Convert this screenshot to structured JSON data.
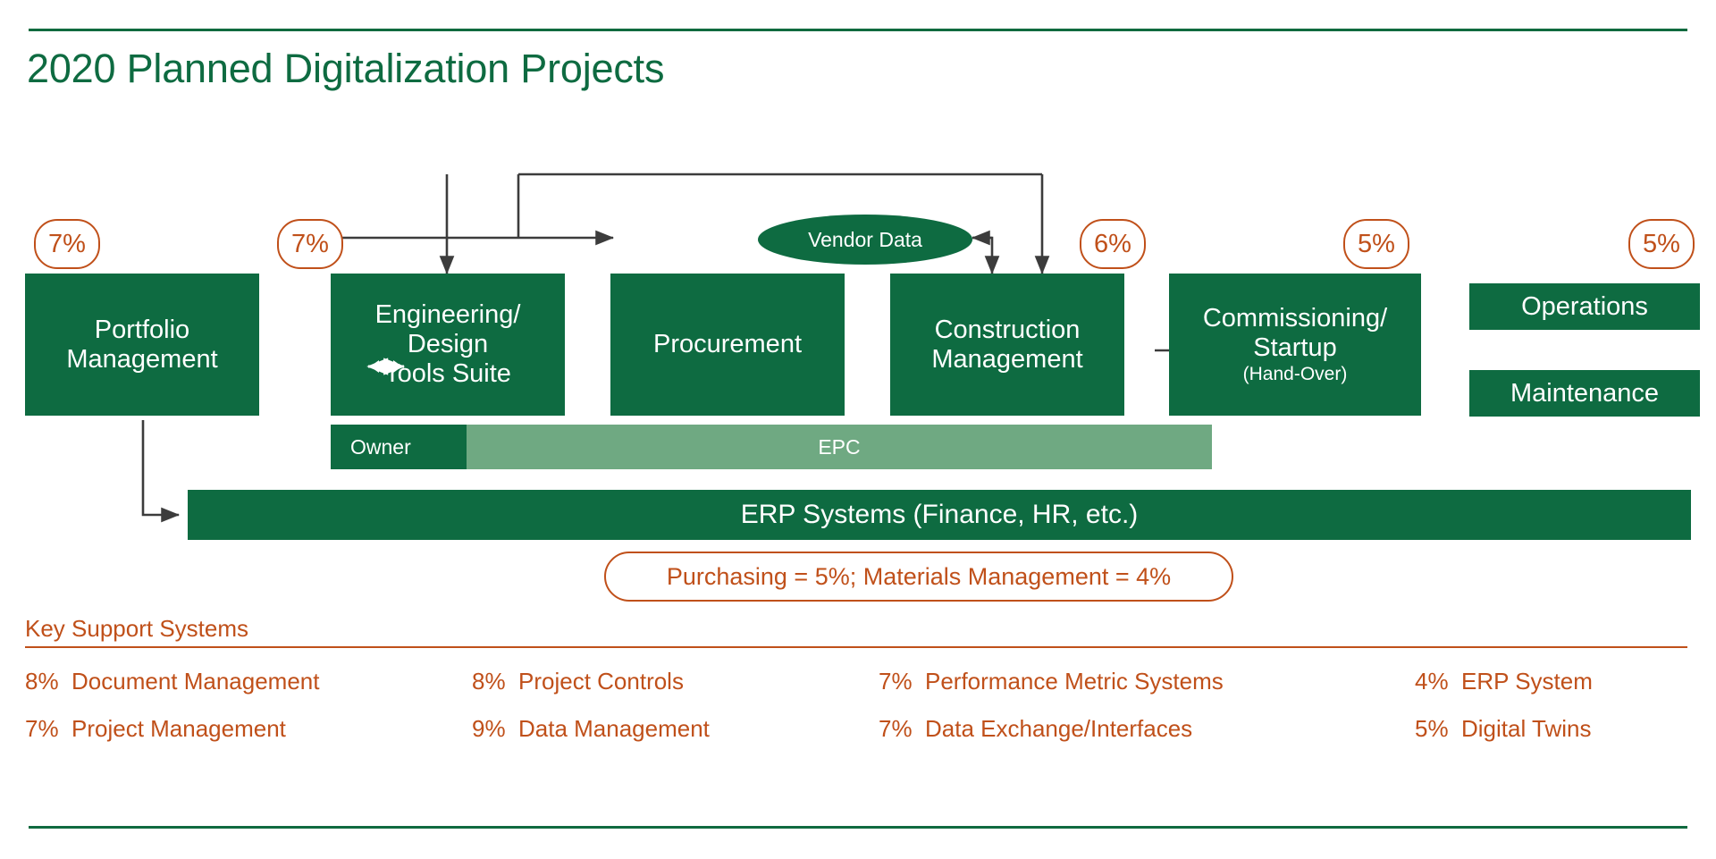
{
  "page": {
    "title": "2020 Planned Digitalization Projects",
    "accent_green": "#0E6B41",
    "accent_orange": "#C0501A",
    "epc_green": "#6FA982"
  },
  "flow": {
    "boxes": [
      {
        "id": "portfolio-management",
        "label_line1": "Portfolio",
        "label_line2": "Management",
        "percent": "7%"
      },
      {
        "id": "engineering-design-tools-suite",
        "label_line1": "Engineering/",
        "label_line2": "Design",
        "label_line3": "Tools Suite",
        "percent": "7%"
      },
      {
        "id": "procurement",
        "label_line1": "Procurement",
        "percent": ""
      },
      {
        "id": "construction-management",
        "label_line1": "Construction",
        "label_line2": "Management",
        "percent": "6%"
      },
      {
        "id": "commissioning-startup",
        "label_line1": "Commissioning/",
        "label_line2": "Startup",
        "sublabel": "(Hand-Over)",
        "percent": "5%"
      },
      {
        "id": "operations",
        "label_line1": "Operations",
        "percent": "5%"
      },
      {
        "id": "maintenance",
        "label_line1": "Maintenance",
        "percent": ""
      }
    ],
    "vendor_data": "Vendor Data",
    "owner_label": "Owner",
    "epc_label": "EPC",
    "erp_bar": "ERP Systems (Finance, HR, etc.)",
    "purchasing_note": "Purchasing = 5%; Materials Management = 4%"
  },
  "support": {
    "heading": "Key Support Systems",
    "items": [
      {
        "percent": "8%",
        "label": "Document Management"
      },
      {
        "percent": "8%",
        "label": "Project Controls"
      },
      {
        "percent": "7%",
        "label": "Performance Metric Systems"
      },
      {
        "percent": "4%",
        "label": "ERP System"
      },
      {
        "percent": "7%",
        "label": "Project Management"
      },
      {
        "percent": "9%",
        "label": "Data Management"
      },
      {
        "percent": "7%",
        "label": "Data Exchange/Interfaces"
      },
      {
        "percent": "5%",
        "label": "Digital Twins"
      }
    ]
  },
  "chart_data": {
    "type": "diagram",
    "title": "2020 Planned Digitalization Projects",
    "process_stages": [
      {
        "name": "Portfolio Management",
        "percent": 7
      },
      {
        "name": "Engineering/Design Tools Suite",
        "percent": 7
      },
      {
        "name": "Procurement",
        "percent": null
      },
      {
        "name": "Construction Management",
        "percent": 6
      },
      {
        "name": "Commissioning/Startup (Hand-Over)",
        "percent": 5
      },
      {
        "name": "Operations",
        "percent": 5
      },
      {
        "name": "Maintenance",
        "percent": null
      }
    ],
    "inline_notes": [
      {
        "name": "Purchasing",
        "percent": 5
      },
      {
        "name": "Materials Management",
        "percent": 4
      }
    ],
    "key_support_systems": [
      {
        "name": "Document Management",
        "percent": 8
      },
      {
        "name": "Project Controls",
        "percent": 8
      },
      {
        "name": "Performance Metric Systems",
        "percent": 7
      },
      {
        "name": "ERP System",
        "percent": 4
      },
      {
        "name": "Project Management",
        "percent": 7
      },
      {
        "name": "Data Management",
        "percent": 9
      },
      {
        "name": "Data Exchange/Interfaces",
        "percent": 7
      },
      {
        "name": "Digital Twins",
        "percent": 5
      }
    ]
  }
}
